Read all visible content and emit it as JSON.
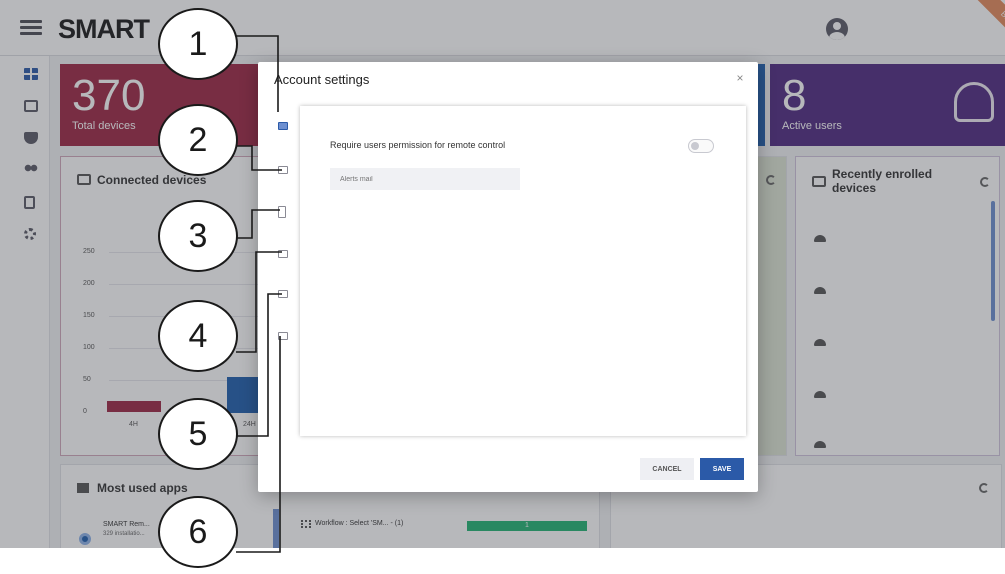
{
  "header": {
    "brand": "SMART",
    "ribbon": "BETA"
  },
  "tiles": {
    "devices": {
      "value": "370",
      "label": "Total devices"
    },
    "users": {
      "value": "8",
      "label": "Active users"
    }
  },
  "connected": {
    "title": "Connected devices",
    "ticks": [
      "250",
      "200",
      "150",
      "100",
      "50",
      "0"
    ],
    "x_labels": [
      "4H",
      "24H"
    ]
  },
  "recent": {
    "title": "Recently enrolled devices"
  },
  "apps": {
    "title": "Most used apps",
    "item_name": "SMART Rem...",
    "item_sub": "329 installatio...",
    "workflow_label": "Workflow : Select 'SM...  - (1)",
    "workflow_value": "1"
  },
  "modal": {
    "title": "Account settings",
    "close": "×",
    "permission_label": "Require users permission for remote control",
    "alerts_placeholder": "Alerts mail",
    "cancel": "CANCEL",
    "save": "SAVE"
  },
  "callouts": [
    "1",
    "2",
    "3",
    "4",
    "5",
    "6"
  ],
  "colors": {
    "brand_blue": "#2b5aa8",
    "devices_tile": "#9d2744",
    "users_tile": "#4f2a80",
    "workflow_green": "#22b573"
  }
}
